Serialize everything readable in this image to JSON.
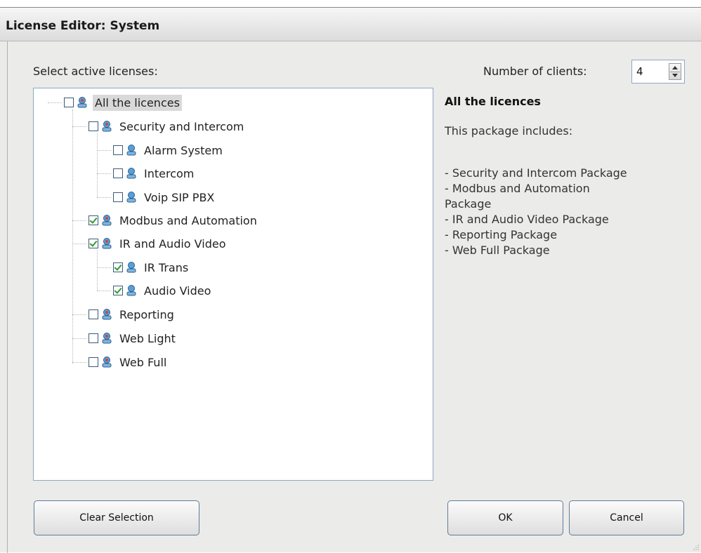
{
  "window": {
    "title": "License Editor: System"
  },
  "labels": {
    "select_active": "Select active licenses:",
    "number_of_clients": "Number of clients:"
  },
  "clients": {
    "value": "4"
  },
  "tree": [
    {
      "label": "All the licences",
      "checked": false,
      "selected": true
    },
    {
      "label": "Security and Intercom",
      "checked": false
    },
    {
      "label": "Alarm System",
      "checked": false
    },
    {
      "label": "Intercom",
      "checked": false
    },
    {
      "label": "Voip SIP PBX",
      "checked": false
    },
    {
      "label": "Modbus and Automation",
      "checked": true
    },
    {
      "label": "IR and Audio Video",
      "checked": true
    },
    {
      "label": "IR Trans",
      "checked": true
    },
    {
      "label": "Audio Video",
      "checked": true
    },
    {
      "label": "Reporting",
      "checked": false
    },
    {
      "label": "Web Light",
      "checked": false
    },
    {
      "label": "Web Full",
      "checked": false
    }
  ],
  "description": {
    "title": "All the licences",
    "intro": "This package includes:",
    "items": [
      "- Security and Intercom Package",
      "- Modbus and Automation",
      "Package",
      "- IR and Audio Video Package",
      "- Reporting Package",
      "- Web Full Package"
    ]
  },
  "buttons": {
    "clear": "Clear Selection",
    "ok": "OK",
    "cancel": "Cancel"
  },
  "icons": {
    "node_icon": "user-network-icon",
    "accent": "#3a8fc8",
    "check_color": "#2c9d2c"
  }
}
